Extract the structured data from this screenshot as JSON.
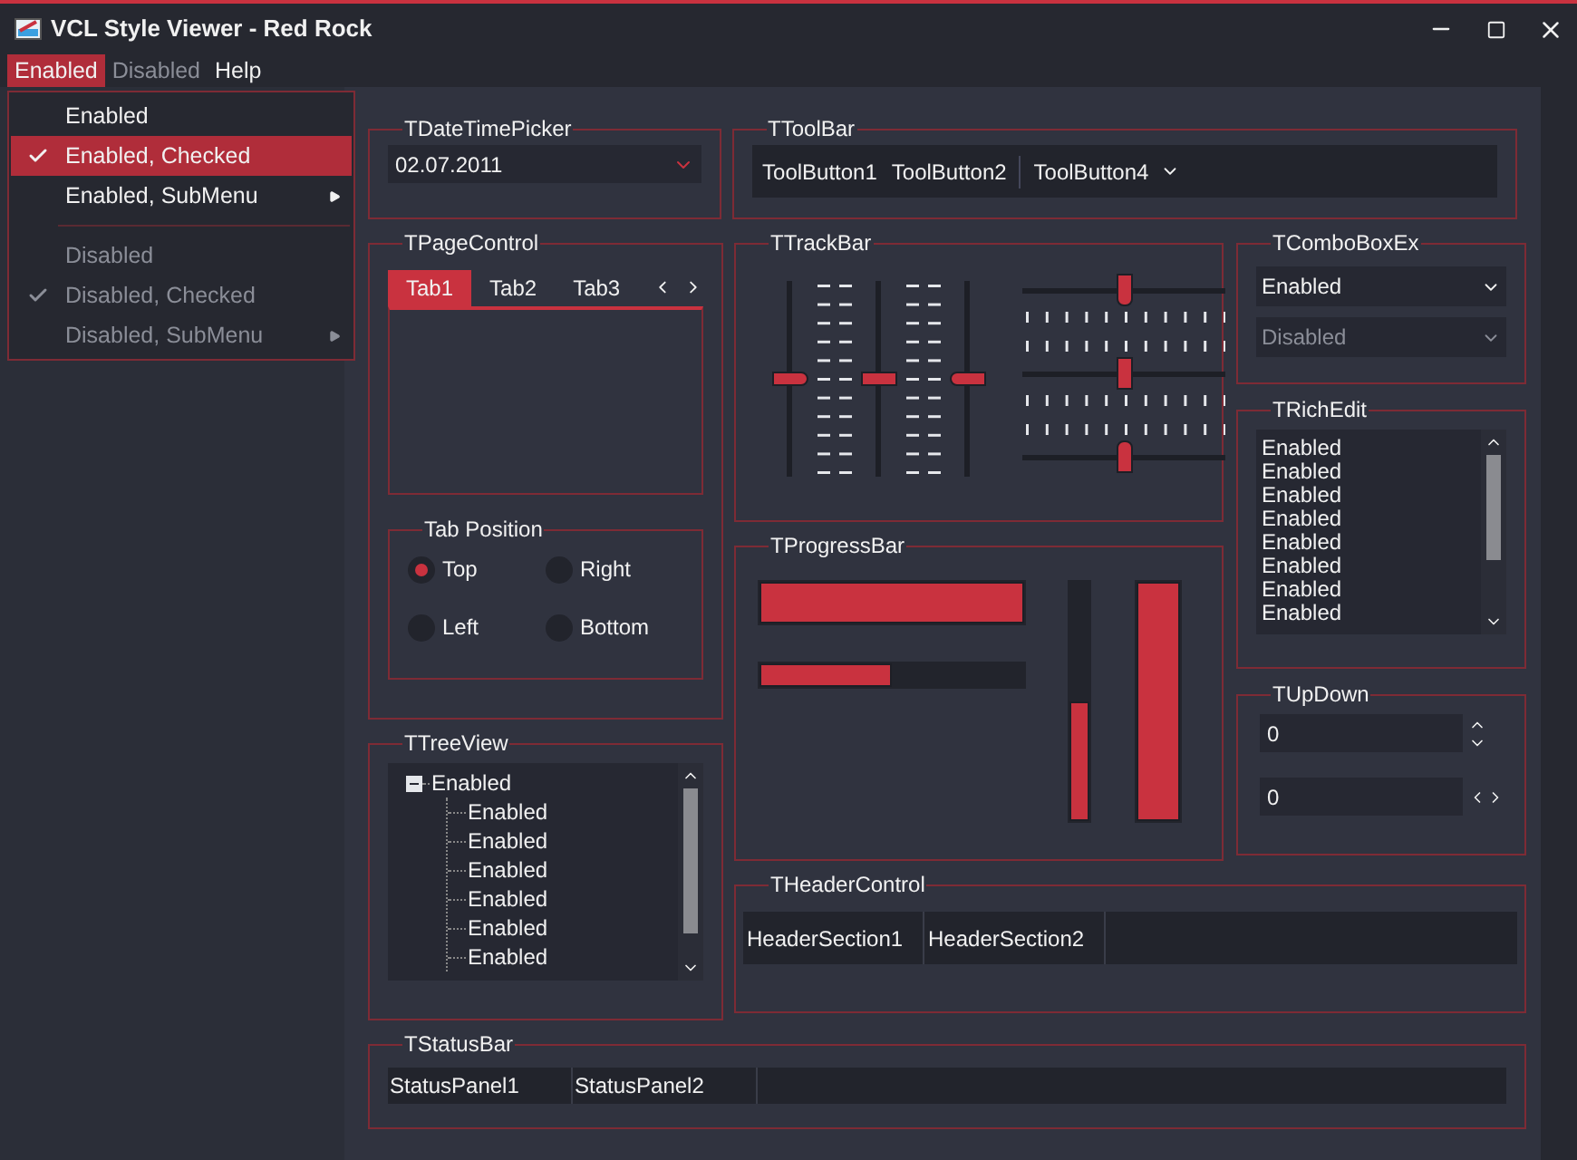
{
  "window": {
    "title": "VCL Style Viewer - Red Rock"
  },
  "menu_bar": [
    {
      "label": "Enabled",
      "selected": true,
      "disabled": false
    },
    {
      "label": "Disabled",
      "selected": false,
      "disabled": true
    },
    {
      "label": "Help",
      "selected": false,
      "disabled": false
    }
  ],
  "menu": [
    {
      "kind": "item",
      "label": "Enabled",
      "checked": false,
      "disabled": false,
      "submenu": false,
      "selected": false
    },
    {
      "kind": "item",
      "label": "Enabled, Checked",
      "checked": true,
      "disabled": false,
      "submenu": false,
      "selected": true
    },
    {
      "kind": "item",
      "label": "Enabled, SubMenu",
      "checked": false,
      "disabled": false,
      "submenu": true,
      "selected": false
    },
    {
      "kind": "separator"
    },
    {
      "kind": "item",
      "label": "Disabled",
      "checked": false,
      "disabled": true,
      "submenu": false,
      "selected": false
    },
    {
      "kind": "item",
      "label": "Disabled, Checked",
      "checked": true,
      "disabled": true,
      "submenu": false,
      "selected": false
    },
    {
      "kind": "item",
      "label": "Disabled, SubMenu",
      "checked": false,
      "disabled": true,
      "submenu": true,
      "selected": false
    }
  ],
  "date_time_picker": {
    "title": "TDateTimePicker",
    "value": "02.07.2011"
  },
  "toolbar": {
    "title": "TToolBar",
    "items": [
      {
        "kind": "button",
        "label": "ToolButton1"
      },
      {
        "kind": "button",
        "label": "ToolButton2"
      },
      {
        "kind": "separator"
      },
      {
        "kind": "dropdown",
        "label": "ToolButton4"
      }
    ]
  },
  "page_control": {
    "title": "TPageControl",
    "tabs": [
      {
        "label": "Tab1",
        "selected": true
      },
      {
        "label": "Tab2",
        "selected": false
      },
      {
        "label": "Tab3",
        "selected": false
      }
    ],
    "radio_group": {
      "title": "Tab Position",
      "options": [
        {
          "label": "Top",
          "selected": true
        },
        {
          "label": "Right",
          "selected": false
        },
        {
          "label": "Left",
          "selected": false
        },
        {
          "label": "Bottom",
          "selected": false
        }
      ]
    }
  },
  "track_bar": {
    "title": "TTrackBar",
    "vertical": [
      {
        "kind": "right",
        "level": 0.5
      },
      {
        "kind": "both",
        "level": 0.5
      },
      {
        "kind": "left",
        "level": 0.5
      }
    ],
    "horizontal": [
      {
        "kind": "below",
        "level": 0.5
      },
      {
        "kind": "both",
        "level": 0.5
      },
      {
        "kind": "above",
        "level": 0.5
      }
    ]
  },
  "combo_box_ex": {
    "title": "TComboBoxEx",
    "items": [
      {
        "value": "Enabled",
        "disabled": false
      },
      {
        "value": "Disabled",
        "disabled": true
      }
    ]
  },
  "rich_edit": {
    "title": "TRichEdit",
    "lines": [
      "Enabled",
      "Enabled",
      "Enabled",
      "Enabled",
      "Enabled",
      "Enabled",
      "Enabled",
      "Enabled"
    ]
  },
  "progress_bar": {
    "title": "TProgressBar",
    "horizontal": [
      {
        "level": 1
      },
      {
        "level": 0.5
      }
    ],
    "vertical": [
      {
        "level": 0.5
      },
      {
        "level": 1
      }
    ]
  },
  "up_down": {
    "title": "TUpDown",
    "fields": [
      {
        "value": "0",
        "kind": "vertical"
      },
      {
        "value": "0",
        "kind": "horizontal"
      }
    ]
  },
  "tree_view": {
    "title": "TTreeView",
    "items": [
      {
        "label": "Enabled",
        "expanded": true,
        "children": [
          {
            "label": "Enabled"
          },
          {
            "label": "Enabled"
          },
          {
            "label": "Enabled"
          },
          {
            "label": "Enabled"
          },
          {
            "label": "Enabled"
          },
          {
            "label": "Enabled"
          }
        ]
      }
    ]
  },
  "header_control": {
    "title": "THeaderControl",
    "sections": [
      "HeaderSection1",
      "HeaderSection2"
    ]
  },
  "status_bar": {
    "title": "TStatusBar",
    "panels": [
      "StatusPanel1",
      "StatusPanel2"
    ]
  }
}
